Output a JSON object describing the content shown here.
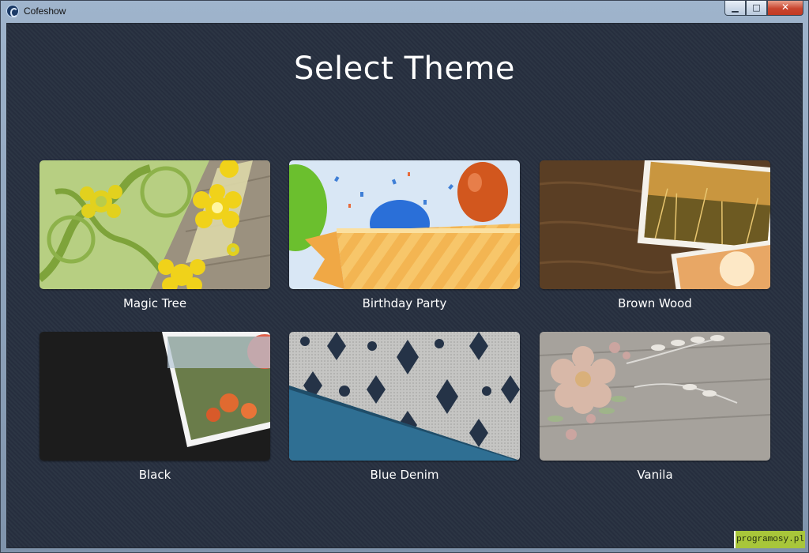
{
  "window": {
    "title": "Cofeshow",
    "controls": {
      "minimize": "▁",
      "maximize": "□",
      "close": "✕"
    }
  },
  "page": {
    "heading": "Select Theme"
  },
  "themes": [
    {
      "label": "Magic Tree"
    },
    {
      "label": "Birthday Party"
    },
    {
      "label": "Brown Wood"
    },
    {
      "label": "Black"
    },
    {
      "label": "Blue Denim"
    },
    {
      "label": "Vanila"
    }
  ],
  "watermark": "programosy.pl",
  "colors": {
    "background": "#273040",
    "text": "#ffffff"
  }
}
